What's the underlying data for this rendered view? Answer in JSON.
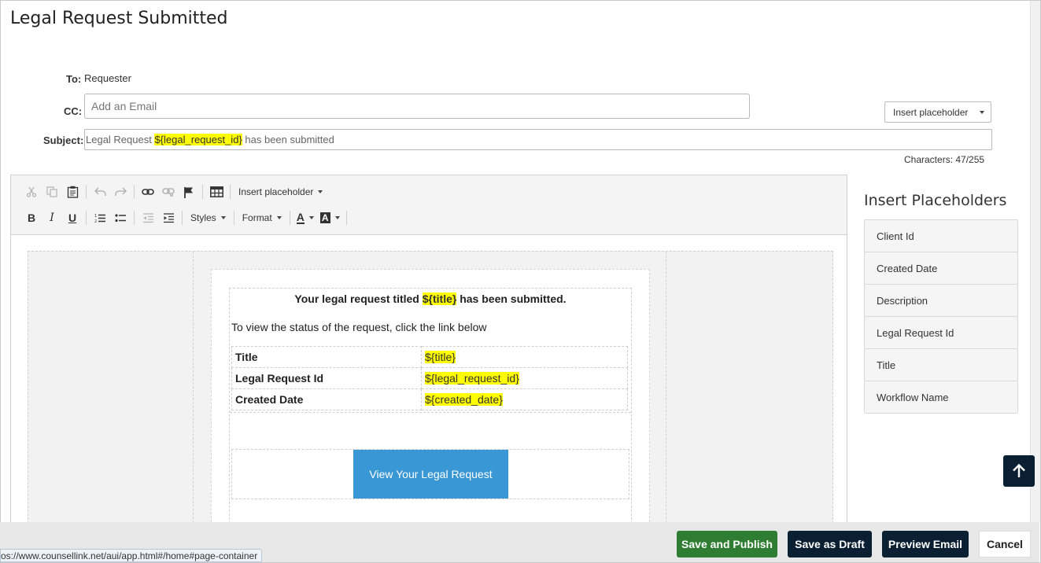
{
  "page": {
    "title": "Legal Request Submitted"
  },
  "form": {
    "to_label": "To:",
    "to_value": "Requester",
    "cc_label": "CC:",
    "cc_placeholder": "Add an Email",
    "subject_label": "Subject:",
    "subject_prefix": "Legal Request ",
    "subject_placeholder_token": "${legal_request_id}",
    "subject_suffix": " has been submitted",
    "insert_placeholder_button": "Insert placeholder",
    "char_count": "Characters: 47/255"
  },
  "toolbar": {
    "insert_placeholder": "Insert placeholder",
    "styles": "Styles",
    "format": "Format",
    "bold": "B",
    "italic": "I",
    "underline": "U",
    "text_color": "A",
    "bg_color": "A"
  },
  "email": {
    "heading_prefix": "Your legal request titled ",
    "heading_token": "${title}",
    "heading_suffix": " has been submitted.",
    "body_text": "To view the status of the request, click the link below",
    "table": [
      {
        "key": "Title",
        "value": "${title}"
      },
      {
        "key": "Legal Request Id",
        "value": "${legal_request_id}"
      },
      {
        "key": "Created Date",
        "value": "${created_date}"
      }
    ],
    "button_label": "View Your Legal Request"
  },
  "placeholders_panel": {
    "title": "Insert Placeholders",
    "items": [
      "Client Id",
      "Created Date",
      "Description",
      "Legal Request Id",
      "Title",
      "Workflow Name"
    ]
  },
  "footer": {
    "save_publish": "Save and Publish",
    "save_draft": "Save as Draft",
    "preview": "Preview Email",
    "cancel": "Cancel"
  },
  "status_bar": {
    "url": "os://www.counsellink.net/aui/app.html#/home#page-container"
  },
  "colors": {
    "highlight": "#ffff00",
    "publish": "#2e7d32",
    "navy": "#0b1f33",
    "email_button": "#3a97d6"
  }
}
